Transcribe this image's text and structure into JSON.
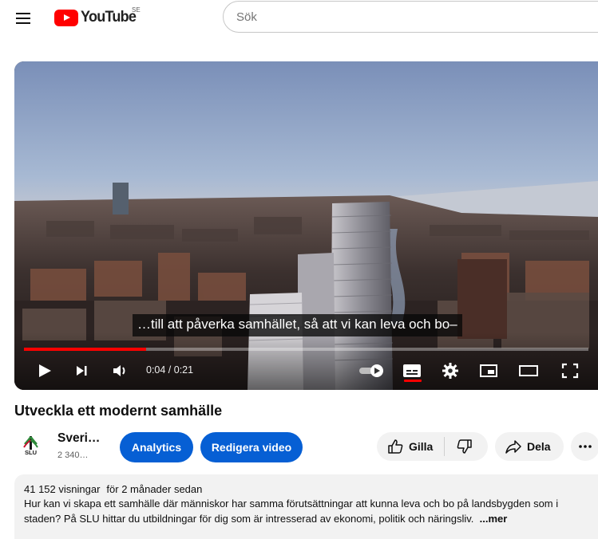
{
  "header": {
    "logo_text": "YouTube",
    "country_code": "SE",
    "search_placeholder": "Sök"
  },
  "player": {
    "caption": "…till att påverka samhället, så att vi kan leva och bo–",
    "time_display": "0:04 / 0:21",
    "progress_played_fraction": 0.216,
    "progress_loaded_fraction": 0.216
  },
  "video": {
    "title": "Utveckla ett modernt samhälle"
  },
  "owner": {
    "channel_name": "Sveri…",
    "subscribers": "2 340…",
    "avatar_label": "SLU",
    "analytics_label": "Analytics",
    "edit_label": "Redigera video"
  },
  "actions": {
    "like_label": "Gilla",
    "share_label": "Dela"
  },
  "description": {
    "views": "41 152 visningar",
    "date": "för 2 månader sedan",
    "text": "Hur kan vi skapa ett samhälle där människor har samma förutsättningar att kunna leva och bo på landsbygden som i staden? På SLU hittar du utbildningar för dig som är intresserad av ekonomi, politik och näringsliv.",
    "more_label": "...mer"
  },
  "colors": {
    "brand_red": "#ff0000",
    "button_blue": "#065fd4"
  }
}
